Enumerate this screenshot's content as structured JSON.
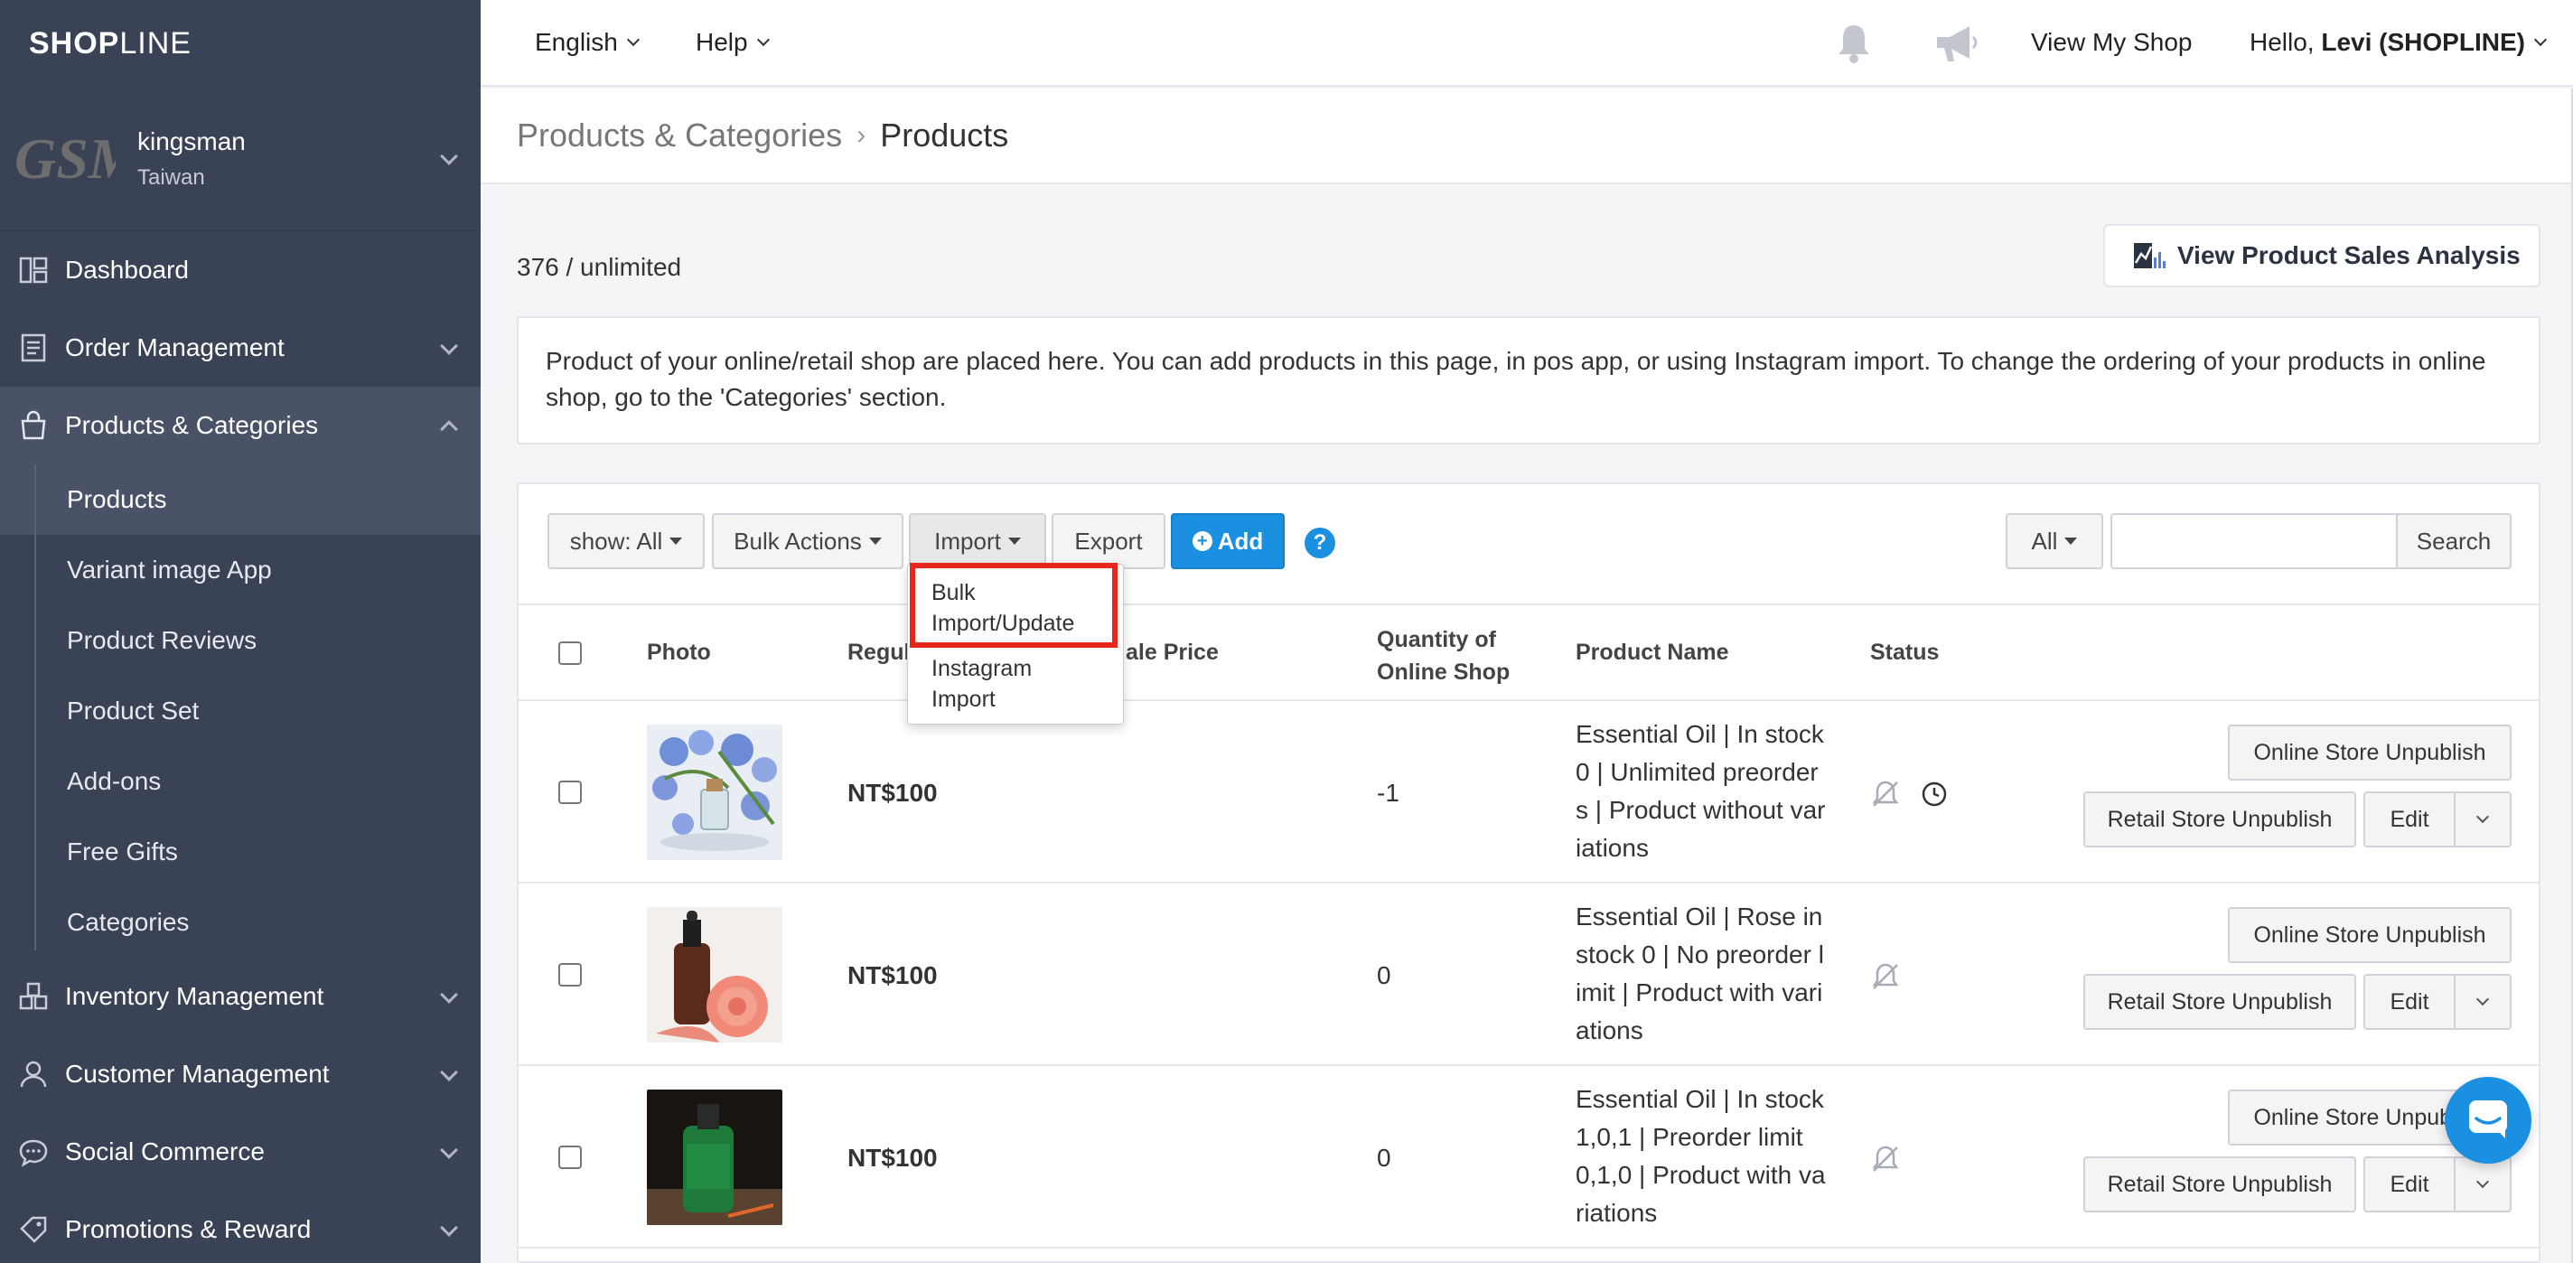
{
  "brand": {
    "logo_bold": "SHOP",
    "logo_thin": "LINE"
  },
  "store": {
    "logo_text": "GSM",
    "name": "kingsman",
    "region": "Taiwan"
  },
  "sidebar": {
    "items": [
      {
        "label": "Dashboard",
        "icon": "dashboard-icon"
      },
      {
        "label": "Order Management",
        "icon": "order-icon"
      },
      {
        "label": "Products & Categories",
        "icon": "bag-icon"
      },
      {
        "label": "Inventory Management",
        "icon": "inventory-icon"
      },
      {
        "label": "Customer Management",
        "icon": "customer-icon"
      },
      {
        "label": "Social Commerce",
        "icon": "chat-icon"
      },
      {
        "label": "Promotions & Reward",
        "icon": "tag-icon"
      }
    ],
    "sub_items": [
      "Products",
      "Variant image App",
      "Product Reviews",
      "Product Set",
      "Add-ons",
      "Free Gifts",
      "Categories"
    ]
  },
  "topbar": {
    "language": "English",
    "help": "Help",
    "view_shop": "View My Shop",
    "greeting": "Hello, ",
    "user": "Levi (SHOPLINE)"
  },
  "breadcrumb": {
    "parent": "Products & Categories",
    "current": "Products"
  },
  "count_text": "376 / unlimited",
  "analysis_button": "View Product Sales Analysis",
  "info_text": "Product of your online/retail shop are placed here. You can add products in this page, in pos app, or using Instagram import. To change the ordering of your products in online shop, go to the 'Categories' section.",
  "toolbar": {
    "show": "show: All",
    "bulk": "Bulk Actions",
    "import": "Import",
    "export": "Export",
    "add": "Add",
    "filter": "All",
    "search": "Search"
  },
  "import_menu": {
    "item1_line1": "Bulk",
    "item1_line2": "Import/Update",
    "item2_line1": "Instagram",
    "item2_line2": "Import"
  },
  "table": {
    "headers": {
      "photo": "Photo",
      "regular": "Regul",
      "sale": "ale Price",
      "qty_line1": "Quantity of",
      "qty_line2": "Online Shop",
      "name": "Product Name",
      "status": "Status"
    },
    "rows": [
      {
        "price": "NT$100",
        "qty": "-1",
        "name": "Essential Oil | In stock 0 | Unlimited preorders | Product without variations",
        "clock": true
      },
      {
        "price": "NT$100",
        "qty": "0",
        "name": "Essential Oil | Rose in stock 0 | No preorder limit | Product with variations",
        "clock": false
      },
      {
        "price": "NT$100",
        "qty": "0",
        "name": "Essential Oil | In stock 1,0,1 | Preorder limit 0,1,0 | Product with variations",
        "clock": false
      }
    ],
    "btn_online": "Online Store Unpublish",
    "btn_retail": "Retail Store Unpublish",
    "btn_edit": "Edit"
  },
  "colors": {
    "sidebar": "#3a4256",
    "primary": "#1b8fe0",
    "highlight": "#e8261c"
  }
}
